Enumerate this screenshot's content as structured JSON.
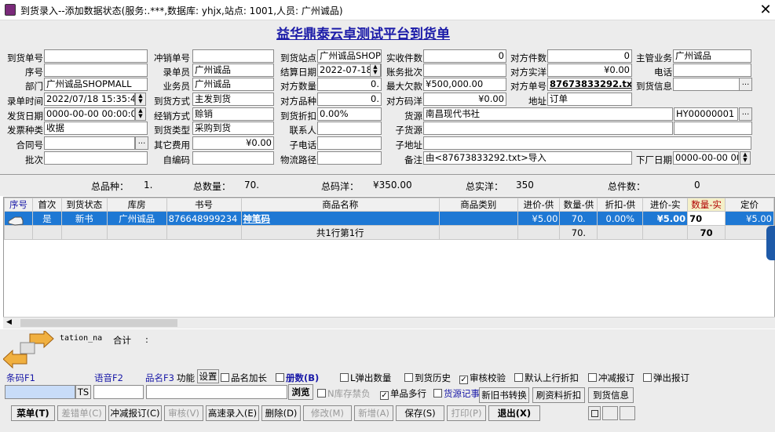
{
  "window": {
    "title": "到货录入--添加数据状态(服务:.***,数据库: yhjx,站点: 1001,人员: 广州诚品)",
    "close": "✕"
  },
  "heading": "益华鼎泰云卓测试平台到货单",
  "form": {
    "c1": [
      {
        "l": "到货单号",
        "v": ""
      },
      {
        "l": "序号",
        "v": ""
      },
      {
        "l": "部门",
        "v": "广州诚品SHOPMALL"
      },
      {
        "l": "录单时间",
        "v": "2022/07/18 15:35:40"
      },
      {
        "l": "发货日期",
        "v": "0000-00-00 00:00:00"
      },
      {
        "l": "发票种类",
        "v": "收据"
      },
      {
        "l": "合同号",
        "v": ""
      },
      {
        "l": "批次",
        "v": ""
      }
    ],
    "c2": [
      {
        "l": "冲销单号",
        "v": ""
      },
      {
        "l": "录单员",
        "v": "广州诚品"
      },
      {
        "l": "业务员",
        "v": "广州诚品"
      },
      {
        "l": "到货方式",
        "v": "主发到货"
      },
      {
        "l": "经销方式",
        "v": "赊销"
      },
      {
        "l": "到货类型",
        "v": "采购到货"
      },
      {
        "l": "其它费用",
        "v": "¥0.00"
      },
      {
        "l": "自编码",
        "v": ""
      }
    ],
    "c3": [
      {
        "l": "到货站点",
        "v": "广州诚品SHOP"
      },
      {
        "l": "结算日期",
        "v": "2022-07-18"
      },
      {
        "l": "对方数量",
        "v": "0."
      },
      {
        "l": "对方品种",
        "v": "0."
      },
      {
        "l": "到货折扣",
        "v": "0.00%"
      },
      {
        "l": "联系人",
        "v": ""
      },
      {
        "l": "子电话",
        "v": ""
      },
      {
        "l": "物流路径",
        "v": ""
      }
    ],
    "c4": [
      {
        "l": "实收件数",
        "v": "0"
      },
      {
        "l": "账务批次",
        "v": ""
      },
      {
        "l": "最大欠款",
        "v": "¥500,000.00"
      },
      {
        "l": "对方码洋",
        "v": "¥0.00"
      }
    ],
    "c5": [
      {
        "l": "对方件数",
        "v": "0"
      },
      {
        "l": "对方实洋",
        "v": "¥0.00"
      },
      {
        "l": "对方单号",
        "v": "87673833292.txt"
      },
      {
        "l": "地址",
        "v": "订单"
      }
    ],
    "c6": [
      {
        "l": "主管业务",
        "v": "广州诚品"
      },
      {
        "l": "电话",
        "v": ""
      },
      {
        "l": "到货信息",
        "v": ""
      }
    ],
    "supplier": {
      "l": "货源",
      "v": "南昌现代书社",
      "code": "HY00000001"
    },
    "subsource": {
      "l": "子货源",
      "v": ""
    },
    "subaddr": {
      "l": "子地址",
      "v": ""
    },
    "remark": {
      "l": "备注",
      "v": "由<87673833292.txt>导入"
    },
    "factory": {
      "l": "下厂日期",
      "v": "0000-00-00 00:"
    },
    "ellipsis": "..."
  },
  "summary": {
    "kinds_label": "总品种：",
    "kinds": "1.",
    "qty_label": "总数量：",
    "qty": "70.",
    "code_label": "总码洋：",
    "code": "¥350.00",
    "real_label": "总实洋：",
    "real": "350",
    "pieces_label": "总件数：",
    "pieces": "0"
  },
  "grid": {
    "headers": [
      "序号",
      "首次",
      "到货状态",
      "库房",
      "书号",
      "商品名称",
      "商品类别",
      "进价-供",
      "数量-供",
      "折扣-供",
      "进价-实",
      "数量-实",
      "定价"
    ],
    "row": [
      "",
      "是",
      "新书",
      "广州诚品",
      "876648999234",
      "神笔码",
      "",
      "¥5.00",
      "70.",
      "0.00%",
      "¥5.00",
      "70",
      "¥5.00"
    ],
    "total": {
      "text": "共1行第1行",
      "qty_sup": "70.",
      "qty_real": "70"
    }
  },
  "bottom": {
    "station_label": "tation_na",
    "total_label": "合计",
    "colon": ":",
    "barcode_label": "条码F1",
    "voice_label": "语音F2",
    "name_label": "品名F3",
    "func_label": "功能",
    "setup": "设置",
    "checks": [
      {
        "t": "品名加长",
        "c": false,
        "b": false,
        "blue": false
      },
      {
        "t": "册数(B)",
        "c": false,
        "b": true,
        "blue": true
      },
      {
        "t": "L弹出数量",
        "c": false,
        "b": false,
        "blue": false
      },
      {
        "t": "到货历史",
        "c": false,
        "b": false,
        "blue": false
      },
      {
        "t": "审核校验",
        "c": true,
        "b": false,
        "blue": false
      },
      {
        "t": "默认上行折扣",
        "c": false,
        "b": false,
        "blue": false
      },
      {
        "t": "冲减报订",
        "c": false,
        "b": false,
        "blue": false
      },
      {
        "t": "弹出报订",
        "c": false,
        "b": false,
        "blue": false
      }
    ],
    "ts": "TS",
    "browse": "浏览",
    "checks2": [
      {
        "t": "N库存禁负",
        "c": false,
        "dis": true
      },
      {
        "t": "单品多行",
        "c": true,
        "dis": false
      },
      {
        "t": "货源记事",
        "c": false,
        "dis": false,
        "blue": true
      }
    ],
    "btns2": [
      "新旧书转换",
      "刷资料折扣",
      "到货信息"
    ],
    "toolbar": [
      {
        "t": "菜单(T)",
        "d": false,
        "b": true
      },
      {
        "t": "差错单(C)",
        "d": true,
        "b": false
      },
      {
        "t": "冲减报订(C)",
        "d": false,
        "b": false
      },
      {
        "t": "审核(V)",
        "d": true,
        "b": false
      },
      {
        "t": "高速录入(E)",
        "d": false,
        "b": false
      },
      {
        "t": "删除(D)",
        "d": false,
        "b": false
      },
      {
        "t": "修改(M)",
        "d": true,
        "b": false
      },
      {
        "t": "新增(A)",
        "d": true,
        "b": false
      },
      {
        "t": "保存(S)",
        "d": false,
        "b": false
      },
      {
        "t": "打印(P)",
        "d": true,
        "b": false
      },
      {
        "t": "退出(X)",
        "d": false,
        "b": true
      }
    ]
  }
}
